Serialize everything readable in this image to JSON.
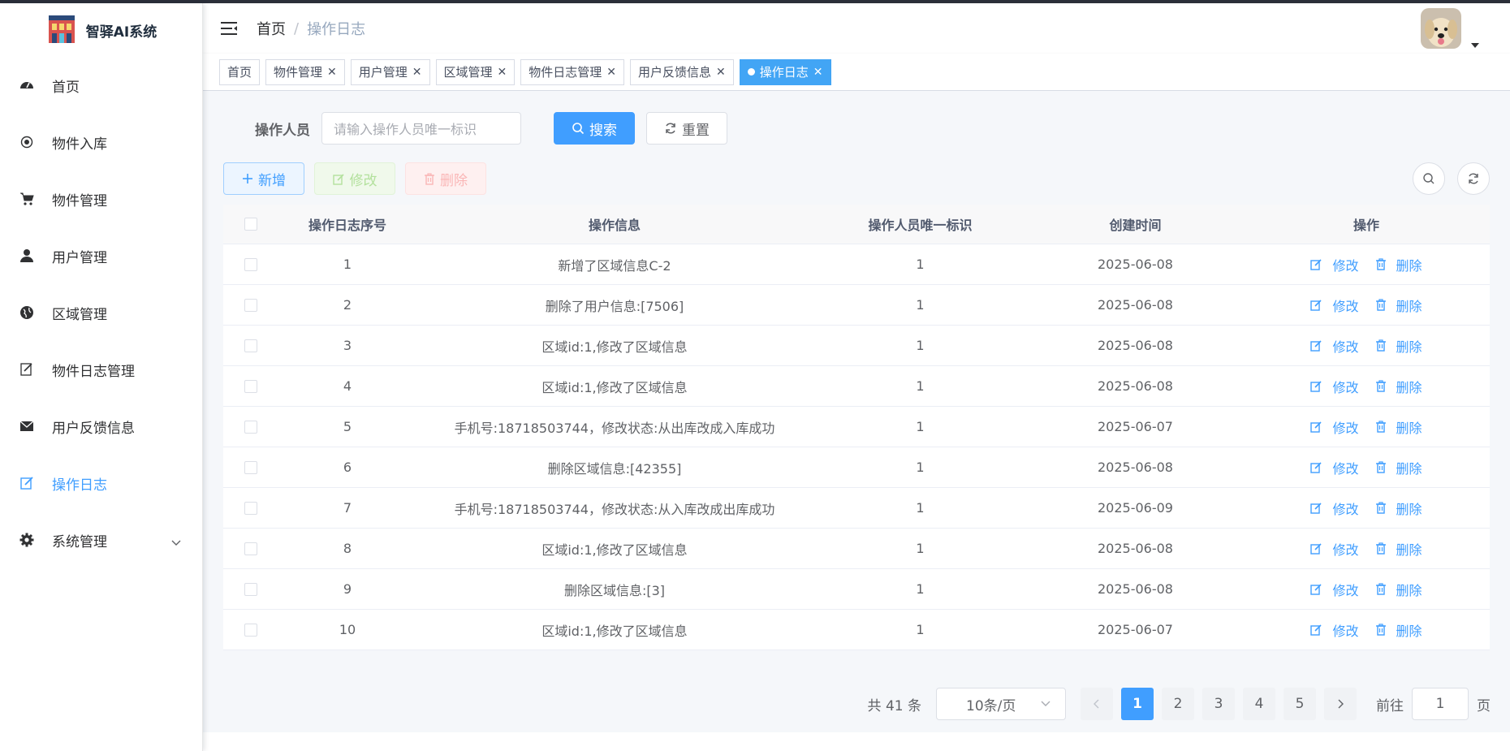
{
  "app": {
    "title": "智驿AI系统"
  },
  "sidebar": {
    "items": [
      {
        "label": "首页",
        "icon": "dashboard-icon"
      },
      {
        "label": "物件入库",
        "icon": "radio-dot-icon"
      },
      {
        "label": "物件管理",
        "icon": "cart-icon"
      },
      {
        "label": "用户管理",
        "icon": "user-icon"
      },
      {
        "label": "区域管理",
        "icon": "globe-icon"
      },
      {
        "label": "物件日志管理",
        "icon": "edit-doc-icon"
      },
      {
        "label": "用户反馈信息",
        "icon": "mail-icon"
      },
      {
        "label": "操作日志",
        "icon": "edit-icon",
        "active": true
      },
      {
        "label": "系统管理",
        "icon": "gear-icon",
        "expandable": true
      }
    ]
  },
  "header": {
    "breadcrumb": {
      "home": "首页",
      "separator": "/",
      "current": "操作日志"
    }
  },
  "tags": [
    {
      "label": "首页",
      "closable": false
    },
    {
      "label": "物件管理",
      "closable": true
    },
    {
      "label": "用户管理",
      "closable": true
    },
    {
      "label": "区域管理",
      "closable": true
    },
    {
      "label": "物件日志管理",
      "closable": true
    },
    {
      "label": "用户反馈信息",
      "closable": true
    },
    {
      "label": "操作日志",
      "closable": true,
      "active": true
    }
  ],
  "search": {
    "label": "操作人员",
    "placeholder": "请输入操作人员唯一标识",
    "search_btn": "搜索",
    "reset_btn": "重置"
  },
  "toolbar": {
    "add": "新增",
    "edit": "修改",
    "delete": "删除"
  },
  "table": {
    "columns": [
      "操作日志序号",
      "操作信息",
      "操作人员唯一标识",
      "创建时间",
      "操作"
    ],
    "action_edit": "修改",
    "action_delete": "删除",
    "rows": [
      {
        "id": "1",
        "info": "新增了区域信息C-2",
        "operator": "1",
        "created": "2025-06-08"
      },
      {
        "id": "2",
        "info": "删除了用户信息:[7506]",
        "operator": "1",
        "created": "2025-06-08"
      },
      {
        "id": "3",
        "info": "区域id:1,修改了区域信息",
        "operator": "1",
        "created": "2025-06-08"
      },
      {
        "id": "4",
        "info": "区域id:1,修改了区域信息",
        "operator": "1",
        "created": "2025-06-08"
      },
      {
        "id": "5",
        "info": "手机号:18718503744，修改状态:从出库改成入库成功",
        "operator": "1",
        "created": "2025-06-07"
      },
      {
        "id": "6",
        "info": "删除区域信息:[42355]",
        "operator": "1",
        "created": "2025-06-08"
      },
      {
        "id": "7",
        "info": "手机号:18718503744，修改状态:从入库改成出库成功",
        "operator": "1",
        "created": "2025-06-09"
      },
      {
        "id": "8",
        "info": "区域id:1,修改了区域信息",
        "operator": "1",
        "created": "2025-06-08"
      },
      {
        "id": "9",
        "info": "删除区域信息:[3]",
        "operator": "1",
        "created": "2025-06-08"
      },
      {
        "id": "10",
        "info": "区域id:1,修改了区域信息",
        "operator": "1",
        "created": "2025-06-07"
      }
    ]
  },
  "pagination": {
    "total": "共 41 条",
    "page_size": "10条/页",
    "pages": [
      "1",
      "2",
      "3",
      "4",
      "5"
    ],
    "current": "1",
    "goto_prefix": "前往",
    "goto_value": "1",
    "goto_suffix": "页"
  },
  "colors": {
    "primary": "#409eff",
    "success_light": "#b3e19d",
    "danger_light": "#fab6b6"
  }
}
